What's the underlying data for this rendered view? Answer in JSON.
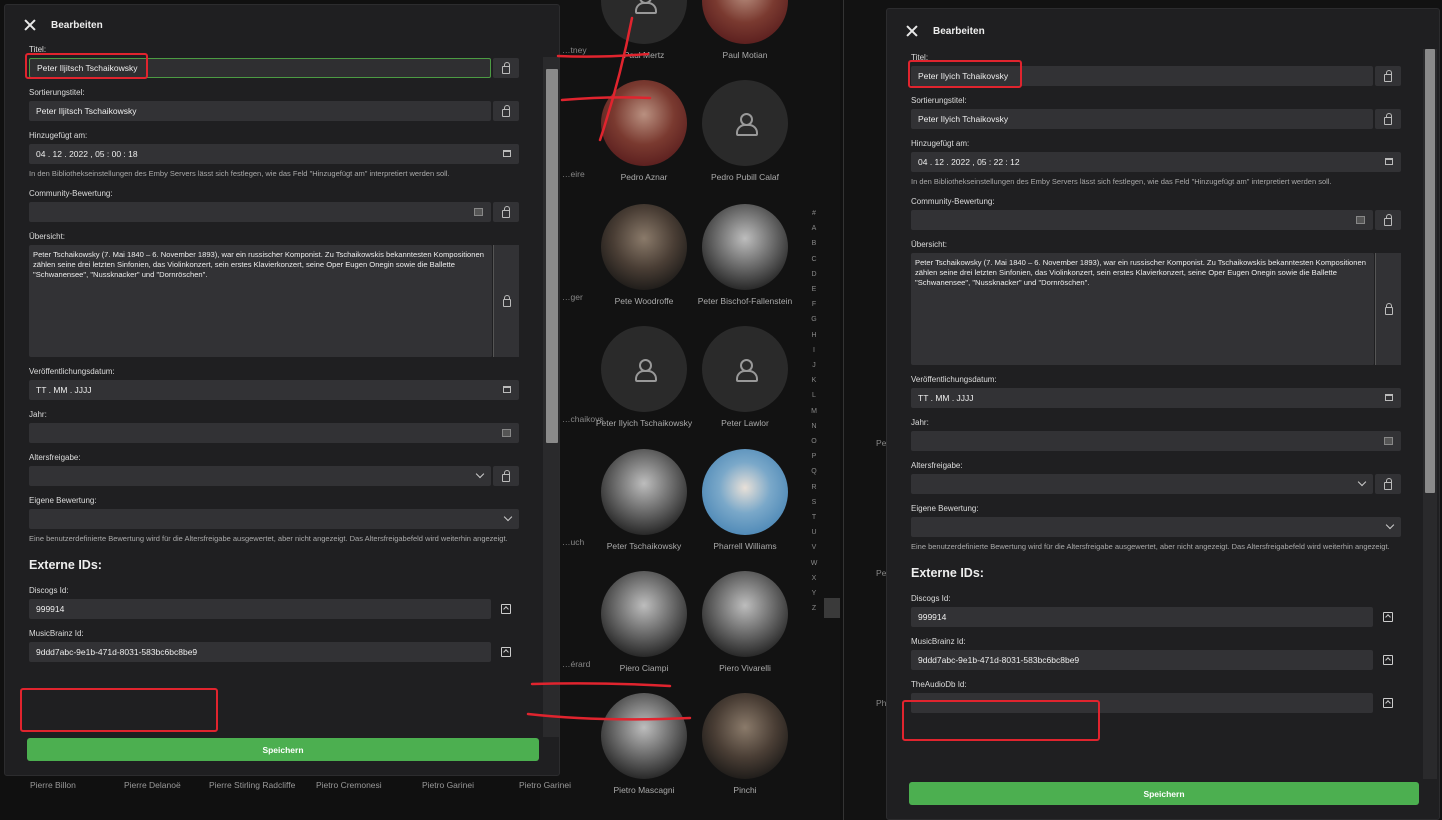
{
  "dialog_title": "Bearbeiten",
  "background": {
    "top_row": [
      "Paul Mertz",
      "Paul Motian"
    ],
    "row2": [
      "Pedro Aznar",
      "Pedro Pubill Calaf"
    ],
    "row3": [
      "Pete Woodroffe",
      "Peter Bischof-Fallenstein"
    ],
    "row4": [
      "Peter Ilyich Tschaikowsky",
      "Peter Lawlor"
    ],
    "row5": [
      "Peter Tschaikowsky",
      "Pharrell Williams"
    ],
    "row6": [
      "Piero Ciampi",
      "Piero Vivarelli"
    ],
    "row7": [
      "Pietro Mascagni",
      "Pinchi"
    ],
    "partial_left": [
      "…tney",
      "…eire",
      "…ger",
      "…chaikovs",
      "…uch",
      "…érard"
    ],
    "bottom_names": [
      "Pierre Billon",
      "Pierre Delanoë",
      "Pierre Stirling Radcliffe",
      "Pietro Cremonesi",
      "Pietro Garinei",
      "Pietro Garinei"
    ],
    "alphabet": [
      "#",
      "A",
      "B",
      "C",
      "D",
      "E",
      "F",
      "G",
      "H",
      "I",
      "J",
      "K",
      "L",
      "M",
      "N",
      "O",
      "P",
      "Q",
      "R",
      "S",
      "T",
      "U",
      "V",
      "W",
      "X",
      "Y",
      "Z"
    ],
    "right_partial": [
      "Pe",
      "Pe",
      "Phi"
    ]
  },
  "left": {
    "title_label": "Titel:",
    "title_value": "Peter Iljitsch Tschaikowsky",
    "sort_label": "Sortierungstitel:",
    "sort_value": "Peter Iljitsch Tschaikowsky",
    "added_label": "Hinzugefügt am:",
    "added_value": "04 . 12 . 2022 ,  05 : 00 : 18",
    "added_help": "In den Bibliothekseinstellungen des Emby Servers lässt sich festlegen, wie das Feld \"Hinzugefügt am\" interpretiert werden soll.",
    "community_label": "Community-Bewertung:",
    "overview_label": "Übersicht:",
    "overview_text": "Peter Tschaikowsky (7. Mai 1840 – 6. November 1893), war ein russischer Komponist. Zu Tschaikowskis bekanntesten Kompositionen zählen seine drei letzten Sinfonien, das Violinkonzert, sein erstes Klavierkonzert, seine Oper Eugen Onegin sowie die Ballette \"Schwanensee\", \"Nussknacker\" und \"Dornröschen\".",
    "release_label": "Veröffentlichungsdatum:",
    "release_placeholder": "TT . MM . JJJJ",
    "year_label": "Jahr:",
    "rating_label": "Altersfreigabe:",
    "own_rating_label": "Eigene Bewertung:",
    "own_rating_help": "Eine benutzerdefinierte Bewertung wird für die Altersfreigabe ausgewertet, aber nicht angezeigt. Das Altersfreigabefeld wird weiterhin angezeigt.",
    "external_title": "Externe IDs:",
    "discogs_label": "Discogs Id:",
    "discogs_value": "999914",
    "mb_label": "MusicBrainz Id:",
    "mb_value": "9ddd7abc-9e1b-471d-8031-583bc6bc8be9",
    "save_label": "Speichern"
  },
  "right": {
    "title_label": "Titel:",
    "title_value": "Peter Ilyich Tchaikovsky",
    "sort_label": "Sortierungstitel:",
    "sort_value": "Peter Ilyich Tchaikovsky",
    "added_label": "Hinzugefügt am:",
    "added_value": "04 . 12 . 2022 ,  05 : 22 : 12",
    "added_help": "In den Bibliothekseinstellungen des Emby Servers lässt sich festlegen, wie das Feld \"Hinzugefügt am\" interpretiert werden soll.",
    "community_label": "Community-Bewertung:",
    "overview_label": "Übersicht:",
    "overview_text": "Peter Tschaikowsky (7. Mai 1840 – 6. November 1893), war ein russischer Komponist. Zu Tschaikowskis bekanntesten Kompositionen zählen seine drei letzten Sinfonien, das Violinkonzert, sein erstes Klavierkonzert, seine Oper Eugen Onegin sowie die Ballette \"Schwanensee\", \"Nussknacker\" und \"Dornröschen\".",
    "release_label": "Veröffentlichungsdatum:",
    "release_placeholder": "TT . MM . JJJJ",
    "year_label": "Jahr:",
    "rating_label": "Altersfreigabe:",
    "own_rating_label": "Eigene Bewertung:",
    "own_rating_help": "Eine benutzerdefinierte Bewertung wird für die Altersfreigabe ausgewertet, aber nicht angezeigt. Das Altersfreigabefeld wird weiterhin angezeigt.",
    "external_title": "Externe IDs:",
    "discogs_label": "Discogs Id:",
    "discogs_value": "999914",
    "mb_label": "MusicBrainz Id:",
    "mb_value": "9ddd7abc-9e1b-471d-8031-583bc6bc8be9",
    "audiodb_label": "TheAudioDb Id:",
    "save_label": "Speichern"
  },
  "colors": {
    "accent": "#4caf50",
    "annotation": "#e0242e",
    "dialog_bg": "#1f1f21",
    "input_bg": "#323235"
  }
}
